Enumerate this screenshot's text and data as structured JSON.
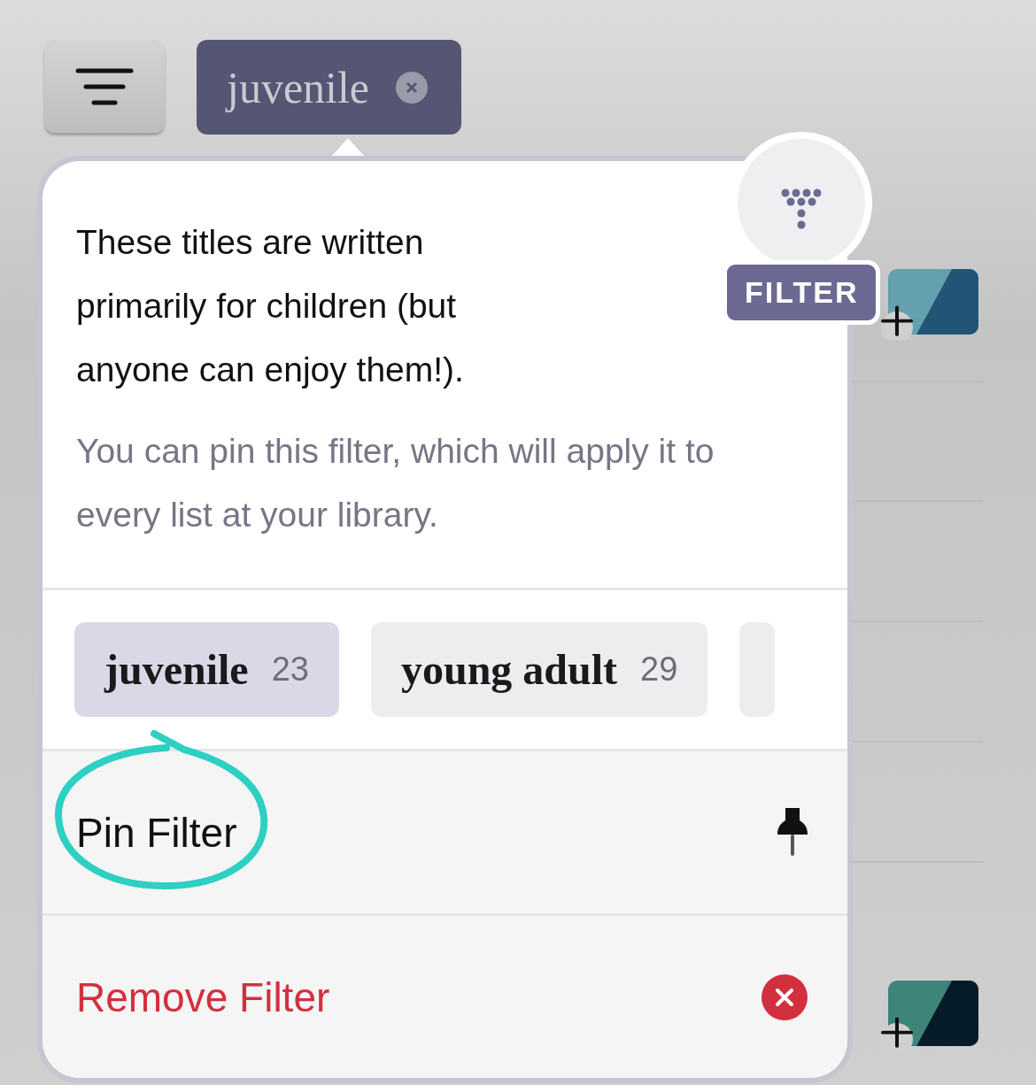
{
  "toolbar": {
    "active_filter": {
      "label": "juvenile"
    }
  },
  "popover": {
    "badge": "FILTER",
    "description": "These titles are written primarily for children (but anyone can enjoy them!).",
    "hint": "You can pin this filter, which will apply it to every list at your library.",
    "options": [
      {
        "label": "juvenile",
        "count": "23",
        "selected": true
      },
      {
        "label": "young adult",
        "count": "29",
        "selected": false
      }
    ],
    "actions": [
      {
        "kind": "pin",
        "label": "Pin Filter",
        "annotated": true
      },
      {
        "kind": "remove",
        "label": "Remove Filter",
        "annotated": false
      }
    ]
  },
  "covers": [
    {
      "parts": [
        {
          "color": "#64a0ae"
        },
        {
          "color": "#215475"
        }
      ]
    },
    {
      "parts": [
        {
          "color": "#3e847a"
        },
        {
          "color": "#061b28"
        }
      ]
    }
  ]
}
